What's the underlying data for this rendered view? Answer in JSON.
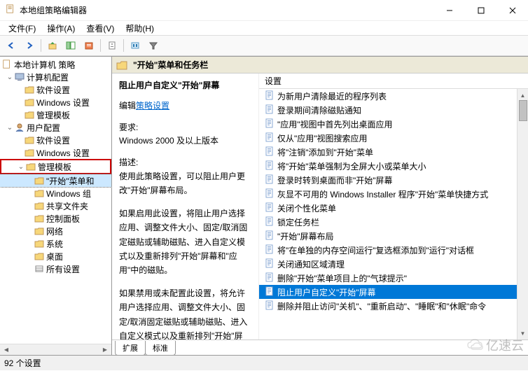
{
  "window": {
    "title": "本地组策略编辑器"
  },
  "menu": {
    "file": "文件(F)",
    "action": "操作(A)",
    "view": "查看(V)",
    "help": "帮助(H)"
  },
  "tree": {
    "root": "本地计算机 策略",
    "comp_cfg": "计算机配置",
    "comp_sw": "软件设置",
    "comp_win": "Windows 设置",
    "comp_admin": "管理模板",
    "user_cfg": "用户配置",
    "user_sw": "软件设置",
    "user_win": "Windows 设置",
    "user_admin": "管理模板",
    "start_taskbar": "\"开始\"菜单和",
    "win_components": "Windows 组",
    "shared_folders": "共享文件夹",
    "control_panel": "控制面板",
    "network": "网络",
    "system": "系统",
    "desktop": "桌面",
    "all_settings": "所有设置"
  },
  "header": {
    "title": "\"开始\"菜单和任务栏"
  },
  "detail": {
    "policy_title": "阻止用户自定义\"开始\"屏幕",
    "edit_prefix": "编辑",
    "edit_link": "策略设置",
    "req_label": "要求:",
    "req_value": "Windows 2000 及以上版本",
    "desc_label": "描述:",
    "desc1": "使用此策略设置，可以阻止用户更改\"开始\"屏幕布局。",
    "desc2": "如果启用此设置，将阻止用户选择应用、调整文件大小、固定/取消固定磁贴或辅助磁贴、进入自定义模式以及重新排列\"开始\"屏幕和\"应用\"中的磁贴。",
    "desc3": "如果禁用或未配置此设置，将允许用户选择应用、调整文件大小、固定/取消固定磁贴或辅助磁贴、进入自定义模式以及重新排列\"开始\"屏"
  },
  "list": {
    "col_setting": "设置",
    "items": [
      "为新用户清除最近的程序列表",
      "登录期间清除磁贴通知",
      "\"应用\"视图中首先列出桌面应用",
      "仅从\"应用\"视图搜索应用",
      "将\"注销\"添加到\"开始\"菜单",
      "将\"开始\"菜单强制为全屏大小或菜单大小",
      "登录时转到桌面而非\"开始\"屏幕",
      "灰显不可用的 Windows Installer 程序\"开始\"菜单快捷方式",
      "关闭个性化菜单",
      "锁定任务栏",
      "\"开始\"屏幕布局",
      "将\"在单独的内存空间运行\"复选框添加到\"运行\"对话框",
      "关闭通知区域清理",
      "删除\"开始\"菜单项目上的\"气球提示\"",
      "阻止用户自定义\"开始\"屏幕",
      "删除并阻止访问\"关机\"、\"重新启动\"、\"睡眠\"和\"休眠\"命令"
    ],
    "selected_index": 14
  },
  "tabs": {
    "ext": "扩展",
    "std": "标准"
  },
  "status": {
    "text": "92 个设置"
  },
  "watermark": {
    "text": "亿速云"
  }
}
